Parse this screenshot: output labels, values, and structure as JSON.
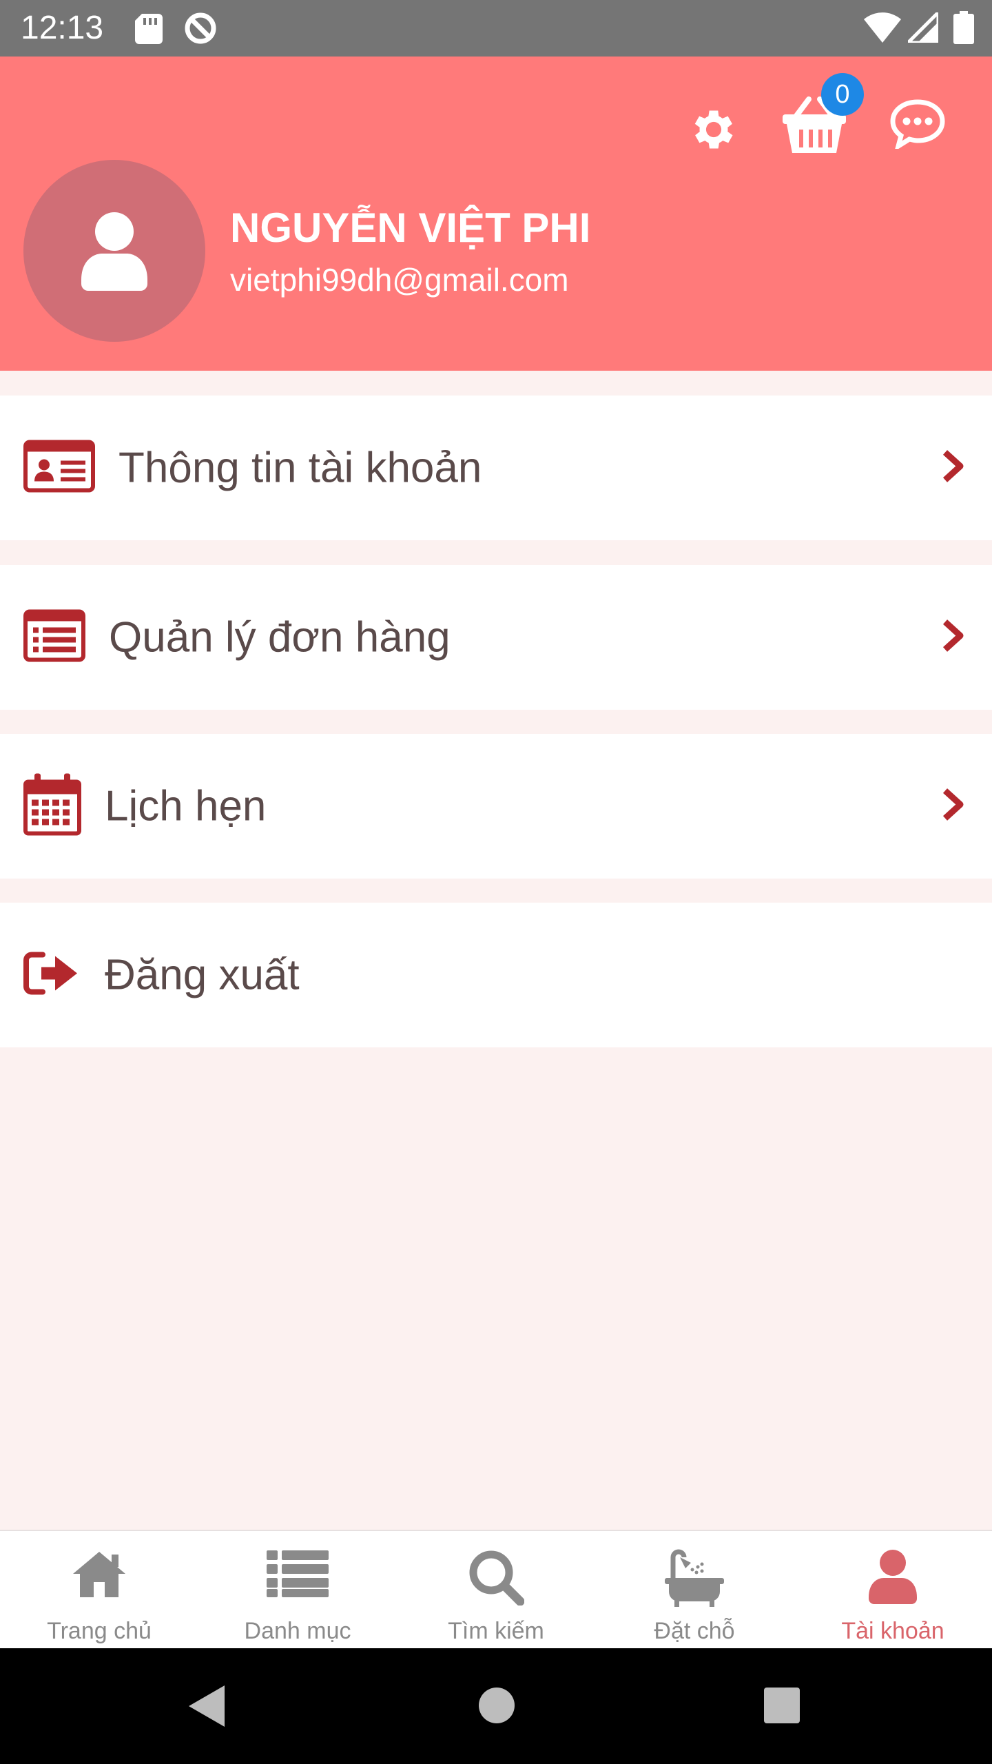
{
  "status_bar": {
    "time": "12:13"
  },
  "header": {
    "cart_count": "0",
    "user_name": "NGUYỄN VIỆT PHI",
    "user_email": "vietphi99dh@gmail.com",
    "background": "#ff7a7a"
  },
  "menu": {
    "items": [
      {
        "label": "Thông tin tài khoản",
        "icon": "id-card-icon"
      },
      {
        "label": "Quản lý đơn hàng",
        "icon": "list-alt-icon"
      },
      {
        "label": "Lịch hẹn",
        "icon": "calendar-icon"
      },
      {
        "label": "Đăng xuất",
        "icon": "sign-out-icon"
      }
    ],
    "accent": "#b3282d"
  },
  "bottom_nav": {
    "items": [
      {
        "label": "Trang chủ",
        "icon": "home-icon"
      },
      {
        "label": "Danh mục",
        "icon": "list-icon"
      },
      {
        "label": "Tìm kiếm",
        "icon": "search-icon"
      },
      {
        "label": "Đặt chỗ",
        "icon": "bath-icon"
      },
      {
        "label": "Tài khoản",
        "icon": "user-icon",
        "active": true
      }
    ],
    "active_color": "#d9646a"
  }
}
